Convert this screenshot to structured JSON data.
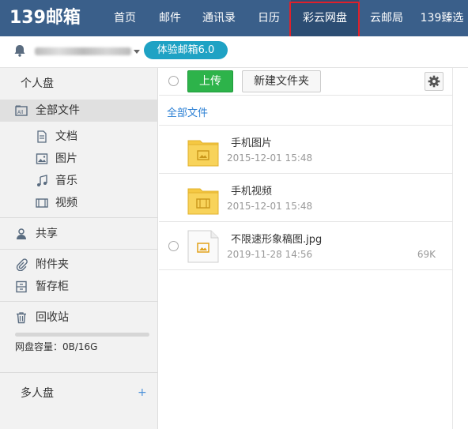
{
  "logo": {
    "text": "139邮箱"
  },
  "nav": {
    "items": [
      {
        "label": "首页"
      },
      {
        "label": "邮件"
      },
      {
        "label": "通讯录"
      },
      {
        "label": "日历"
      },
      {
        "label": "彩云网盘",
        "active": true
      },
      {
        "label": "云邮局"
      },
      {
        "label": "139臻选"
      }
    ]
  },
  "subbar": {
    "trial_label": "体验邮箱6.0"
  },
  "sidebar": {
    "personal_disk": "个人盘",
    "all_files": "全部文件",
    "documents": "文档",
    "images": "图片",
    "music": "音乐",
    "videos": "视频",
    "share": "共享",
    "attachments": "附件夹",
    "temp_cabinet": "暂存柜",
    "recycle": "回收站",
    "capacity_text": "网盘容量：0B/16G",
    "capacity_fraction": 0.0,
    "multi_disk": "多人盘",
    "add_symbol": "+"
  },
  "toolbar": {
    "upload_label": "上传",
    "new_folder_label": "新建文件夹"
  },
  "breadcrumb": {
    "label": "全部文件"
  },
  "files": [
    {
      "name": "手机图片",
      "date": "2015-12-01 15:48",
      "size": "",
      "kind": "folder",
      "badge": "image"
    },
    {
      "name": "手机视频",
      "date": "2015-12-01 15:48",
      "size": "",
      "kind": "folder",
      "badge": "video"
    },
    {
      "name": "不限速形象稿图.jpg",
      "date": "2019-11-28 14:56",
      "size": "69K",
      "kind": "file",
      "badge": "image"
    }
  ],
  "colors": {
    "topbar": "#3a5f8a",
    "active_nav": "#2c4d73",
    "highlight": "#e0202a",
    "badge": "#1fa2c4",
    "upload": "#2db34a",
    "link": "#2a7fd4",
    "folder": "#f5c842"
  }
}
